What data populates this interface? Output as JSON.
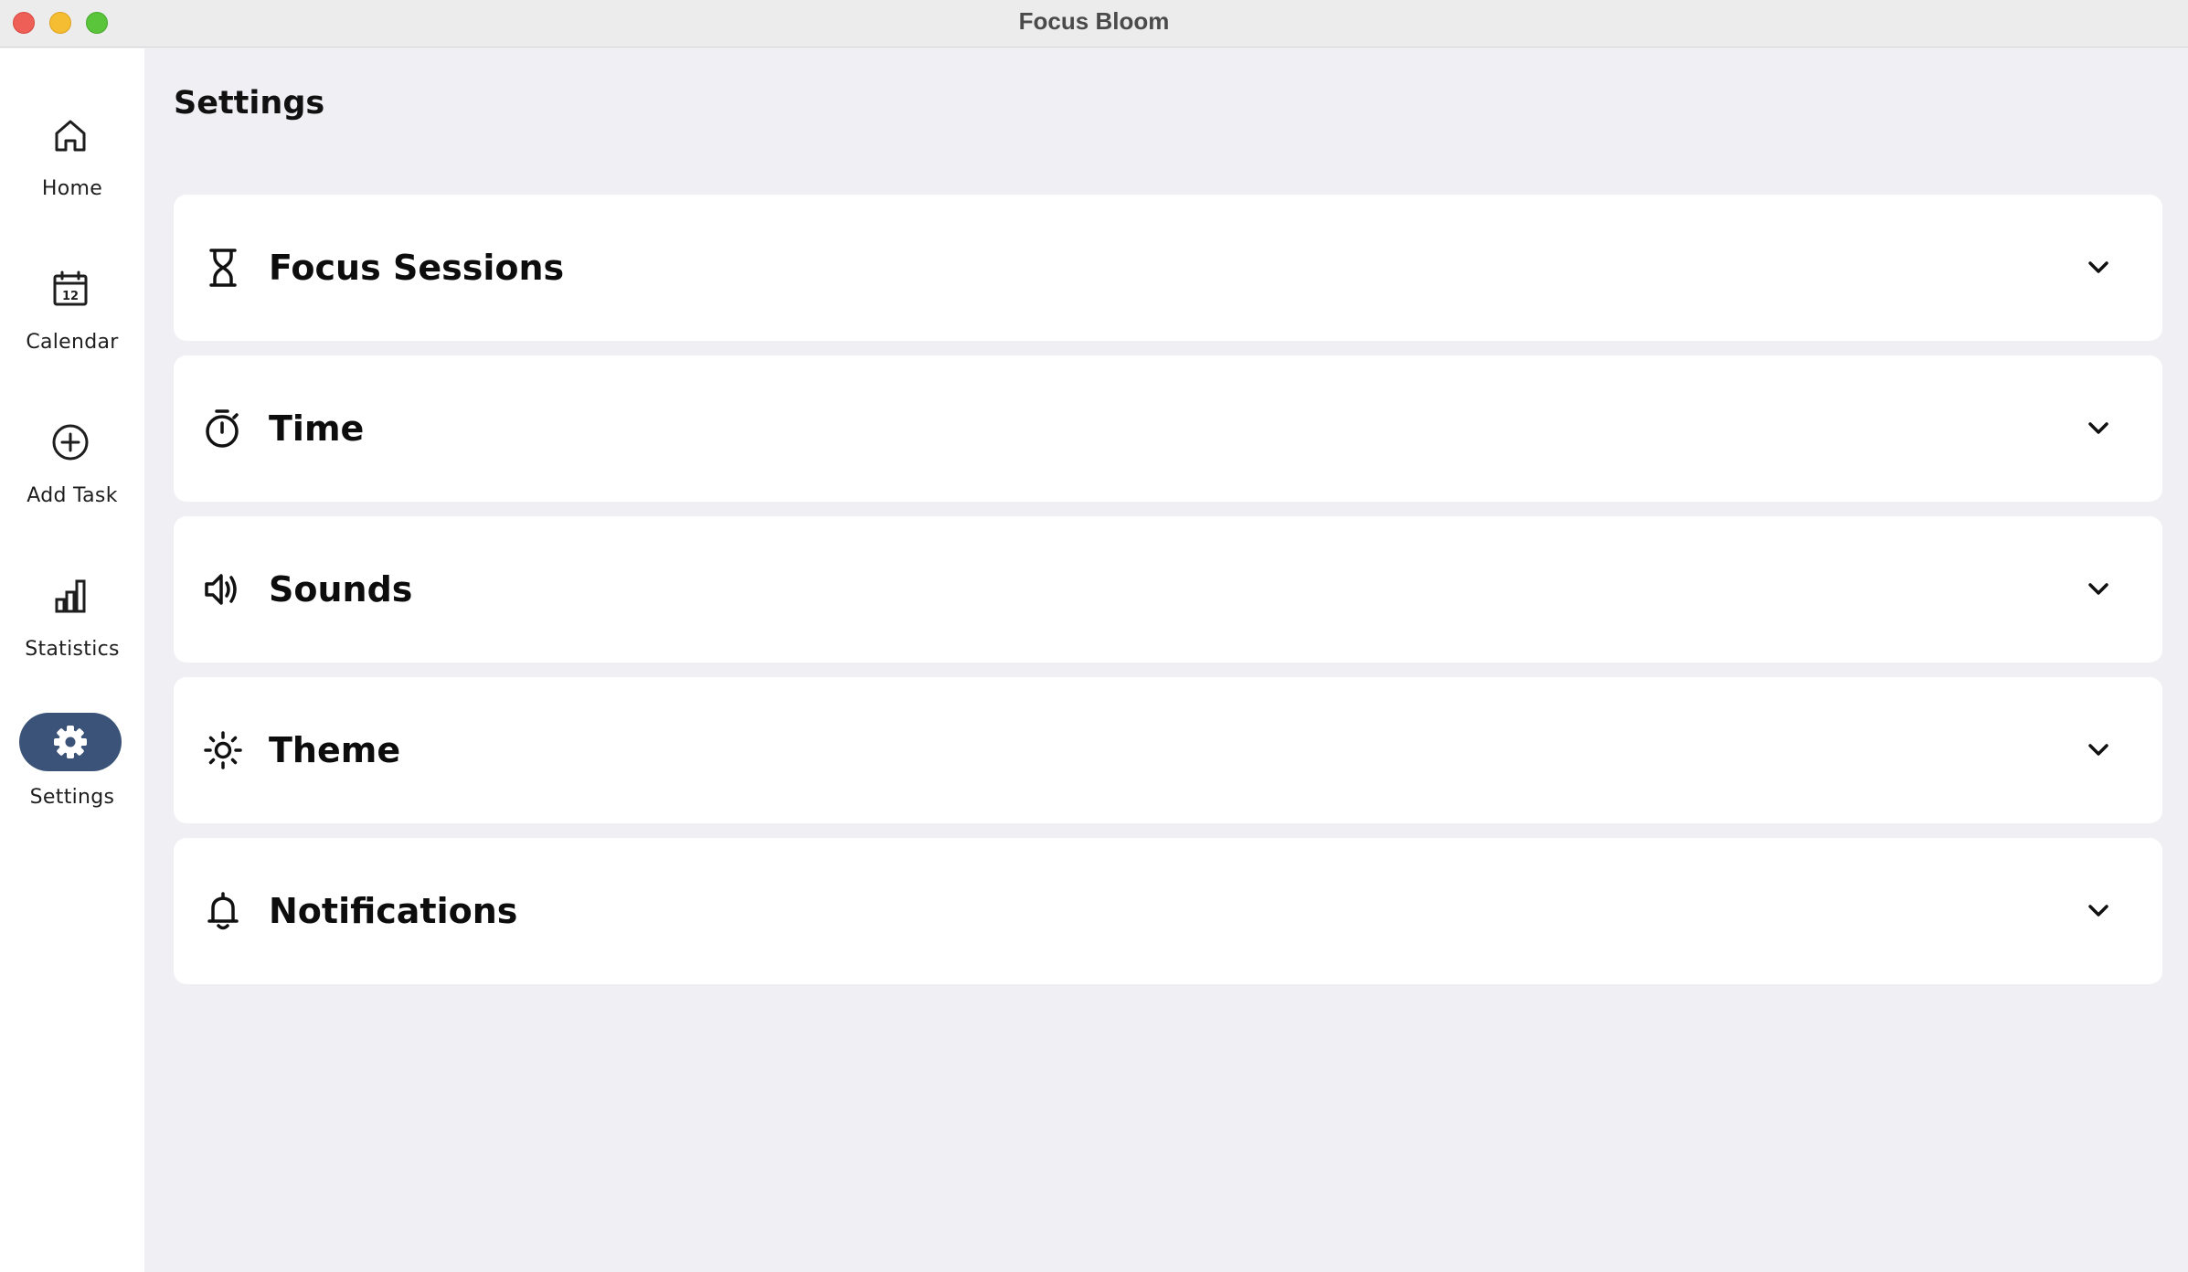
{
  "window": {
    "title": "Focus Bloom"
  },
  "sidebar": {
    "items": [
      {
        "label": "Home",
        "icon": "home-icon",
        "active": false
      },
      {
        "label": "Calendar",
        "icon": "calendar-icon",
        "active": false,
        "icon_text": "12"
      },
      {
        "label": "Add Task",
        "icon": "add-circle-icon",
        "active": false
      },
      {
        "label": "Statistics",
        "icon": "bar-chart-icon",
        "active": false
      },
      {
        "label": "Settings",
        "icon": "gear-icon",
        "active": true
      }
    ]
  },
  "main": {
    "title": "Settings",
    "sections": [
      {
        "label": "Focus Sessions",
        "icon": "hourglass-icon"
      },
      {
        "label": "Time",
        "icon": "stopwatch-icon"
      },
      {
        "label": "Sounds",
        "icon": "speaker-icon"
      },
      {
        "label": "Theme",
        "icon": "sun-icon"
      },
      {
        "label": "Notifications",
        "icon": "bell-icon"
      }
    ]
  },
  "colors": {
    "active_nav_bg": "#3b5378",
    "page_bg": "#f0f0f4",
    "card_bg": "#ffffff",
    "sidebar_bg": "#ffffff"
  }
}
